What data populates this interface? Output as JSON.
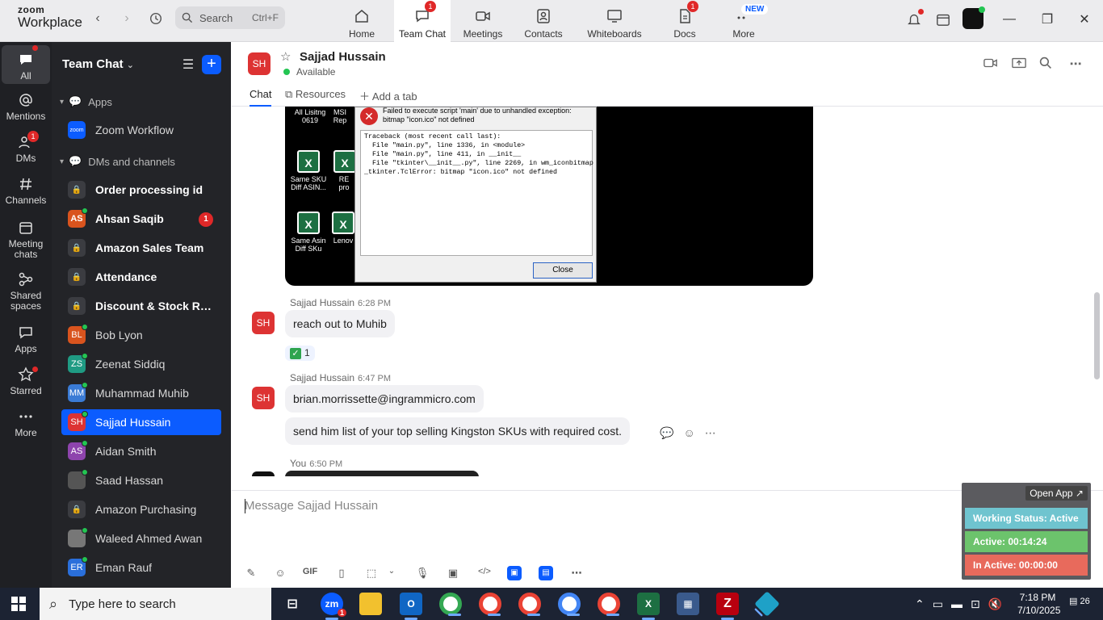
{
  "app": {
    "brand_top": "zoom",
    "brand_bottom": "Workplace"
  },
  "search": {
    "label": "Search",
    "shortcut": "Ctrl+F"
  },
  "nav_tabs": [
    {
      "label": "Home",
      "icon": "home-icon"
    },
    {
      "label": "Team Chat",
      "icon": "chat-icon",
      "badge": "1",
      "active": true
    },
    {
      "label": "Meetings",
      "icon": "video-icon"
    },
    {
      "label": "Contacts",
      "icon": "contacts-icon"
    },
    {
      "label": "Whiteboards",
      "icon": "whiteboard-icon"
    },
    {
      "label": "Docs",
      "icon": "docs-icon",
      "badge": "1"
    },
    {
      "label": "More",
      "icon": "more-icon",
      "new_badge": "NEW"
    }
  ],
  "rail": [
    {
      "label": "All",
      "icon": "chat-bubble-icon"
    },
    {
      "label": "Mentions",
      "icon": "at-icon"
    },
    {
      "label": "DMs",
      "icon": "people-icon",
      "badge": "1"
    },
    {
      "label": "Channels",
      "icon": "hash-icon"
    },
    {
      "label": "Meeting chats",
      "icon": "calendar-icon"
    },
    {
      "label": "Shared spaces",
      "icon": "shared-icon"
    },
    {
      "label": "Apps",
      "icon": "apps-icon"
    },
    {
      "label": "Starred",
      "icon": "star-icon"
    },
    {
      "label": "More",
      "icon": "ellipsis-icon"
    }
  ],
  "sidebar": {
    "title": "Team Chat",
    "apps_section": "Apps",
    "app_item": "Zoom Workflow",
    "dm_section": "DMs and channels",
    "items": [
      {
        "name": "Order processing id",
        "type": "lock",
        "bold": true
      },
      {
        "name": "Ahsan Saqib",
        "initials": "AS",
        "color": "#d9541e",
        "bold": true,
        "badge": "1",
        "online": true
      },
      {
        "name": "Amazon Sales Team",
        "type": "lock",
        "bold": true
      },
      {
        "name": "Attendance",
        "type": "lock",
        "bold": true
      },
      {
        "name": "Discount & Stock Res...",
        "type": "lock",
        "bold": true
      },
      {
        "name": "Bob Lyon",
        "initials": "BL",
        "color": "#d9541e",
        "online": true
      },
      {
        "name": "Zeenat Siddiq",
        "initials": "ZS",
        "color": "#1f9b83",
        "online": true
      },
      {
        "name": "Muhammad Muhib",
        "initials": "MM",
        "color": "#3a7bd5",
        "online": true
      },
      {
        "name": "Sajjad Hussain",
        "initials": "SH",
        "color": "#d33",
        "selected": true,
        "online": true
      },
      {
        "name": "Aidan Smith",
        "initials": "AS",
        "color": "#8e44ad",
        "online": true
      },
      {
        "name": "Saad Hassan",
        "initials": "",
        "color": "#555",
        "online": true
      },
      {
        "name": "Amazon Purchasing",
        "type": "lock"
      },
      {
        "name": "Waleed Ahmed Awan",
        "initials": "",
        "color": "#777",
        "online": true
      },
      {
        "name": "Eman Rauf",
        "initials": "ER",
        "color": "#2a6fdb",
        "online": true
      }
    ]
  },
  "chat": {
    "contact_initials": "SH",
    "contact_name": "Sajjad Hussain",
    "status": "Available",
    "tabs": [
      "Chat",
      "Resources",
      "Add a tab"
    ],
    "screenshot": {
      "error_title": "Failed to execute script 'main' due to unhandled exception: bitmap \"icon.ico\" not defined",
      "traceback": "Traceback (most recent call last):\n  File \"main.py\", line 1336, in <module>\n  File \"main.py\", line 411, in __init__\n  File \"tkinter\\__init__.py\", line 2269, in wm_iconbitmap\n_tkinter.TclError: bitmap \"icon.ico\" not defined",
      "close_label": "Close",
      "files": [
        "All Lisitng 0619",
        "Same SKU Diff ASIN...",
        "Same Asin Diff SKu",
        "MSI Rep",
        "RE pro",
        "Lenov"
      ]
    },
    "messages": [
      {
        "sender": "Sajjad Hussain",
        "time": "6:28 PM",
        "text": "reach out to Muhib",
        "reaction": "1"
      },
      {
        "sender": "Sajjad Hussain",
        "time": "6:47 PM",
        "text": "brian.morrissette@ingrammicro.com",
        "text2": "send him list of your top selling Kingston SKUs with required cost."
      },
      {
        "sender": "You",
        "time": "6:50 PM"
      }
    ],
    "composer_placeholder": "Message Sajjad Hussain",
    "composer_tools": [
      "GIF"
    ]
  },
  "widget": {
    "open_app": "Open App ↗",
    "working_status": "Working Status: Active",
    "active": "Active: 00:14:24",
    "inactive": "In Active: 00:00:00",
    "colors": {
      "status": "#6fc4cf",
      "active": "#6cc36c",
      "inactive": "#e86a5c"
    }
  },
  "taskbar": {
    "search_placeholder": "Type here to search",
    "time": "7:18 PM",
    "date": "7/10/2025",
    "notifications": "26",
    "zoom_badge": "1"
  }
}
